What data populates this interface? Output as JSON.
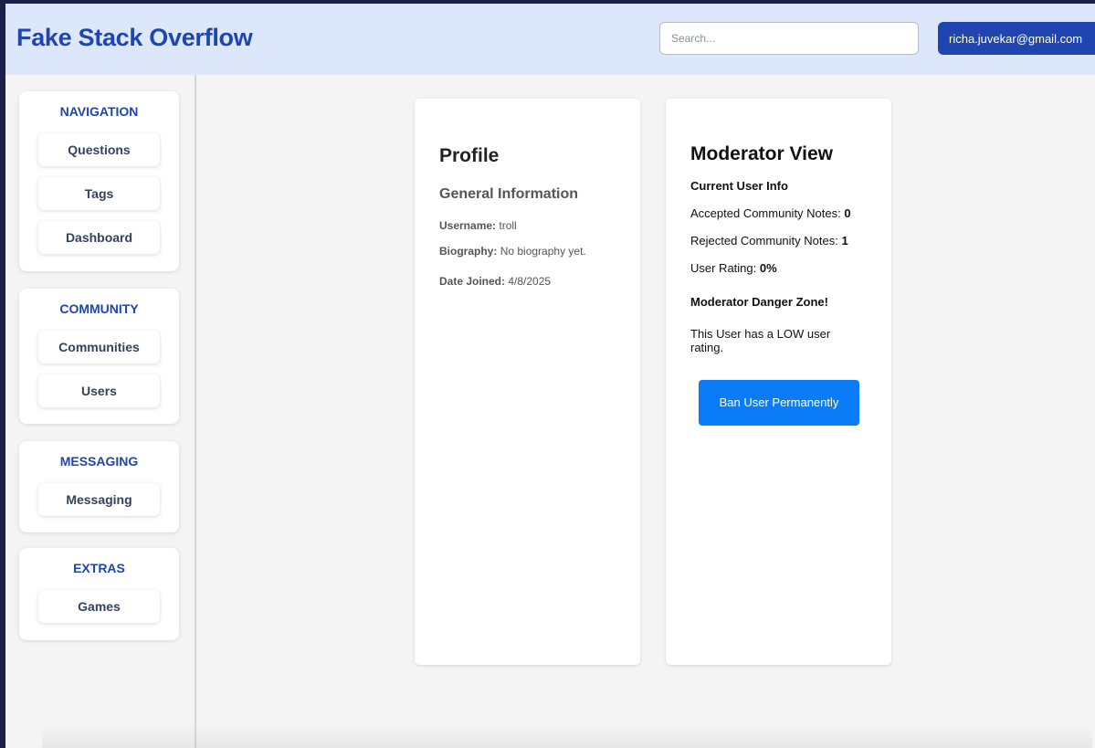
{
  "header": {
    "title": "Fake Stack Overflow",
    "search_placeholder": "Search...",
    "user_email": "richa.juvekar@gmail.com"
  },
  "sidebar": {
    "groups": [
      {
        "title": "NAVIGATION",
        "items": [
          "Questions",
          "Tags",
          "Dashboard"
        ]
      },
      {
        "title": "COMMUNITY",
        "items": [
          "Communities",
          "Users"
        ]
      },
      {
        "title": "MESSAGING",
        "items": [
          "Messaging"
        ]
      },
      {
        "title": "EXTRAS",
        "items": [
          "Games"
        ]
      }
    ]
  },
  "profile": {
    "title": "Profile",
    "section": "General Information",
    "username_label": "Username:",
    "username": "troll",
    "biography_label": "Biography:",
    "biography": "No biography yet.",
    "date_joined_label": "Date Joined:",
    "date_joined": "4/8/2025"
  },
  "moderator": {
    "title": "Moderator View",
    "current_user_info": "Current User Info",
    "accepted_label": "Accepted Community Notes:",
    "accepted_value": "0",
    "rejected_label": "Rejected Community Notes:",
    "rejected_value": "1",
    "rating_label": "User Rating:",
    "rating_value": "0%",
    "danger_zone": "Moderator Danger Zone!",
    "low_rating_text": "This User has a LOW user rating.",
    "ban_button": "Ban User Permanently"
  },
  "colors": {
    "brand": "#1f45b0",
    "header_bg": "#dce7fb",
    "ban_button": "#0a7cf8"
  }
}
